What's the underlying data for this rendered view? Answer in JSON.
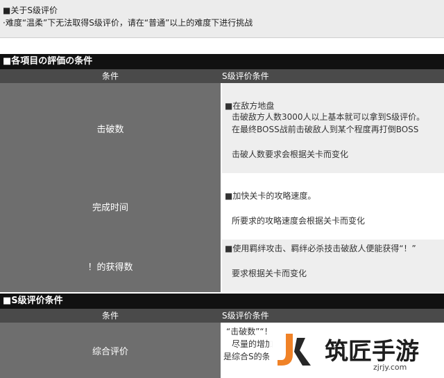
{
  "note": {
    "title": "■关于S级评价",
    "desc": "·难度“温柔”下无法取得S级评价，请在“普通”以上的难度下进行挑战"
  },
  "section1": {
    "title": "■各項目の評価の条件",
    "header": {
      "col1": "条件",
      "col2": "S级评价条件"
    },
    "rows": [
      {
        "label": "击破数",
        "lines": [
          "■在敌方地盘",
          "击破敌方人数3000人以上基本就可以拿到S级评价。",
          "在最终BOSS战前击破敌人到某个程度再打倒BOSS",
          "击破人数要求会根据关卡而变化"
        ]
      },
      {
        "label": "完成时间",
        "lines": [
          "■加快关卡的攻略速度。",
          "所要求的攻略速度会根据关卡而变化"
        ]
      },
      {
        "label": "！的获得数",
        "lines": [
          "■使用羁绊攻击、羁绊必杀技击破敌人便能获得“！”",
          "要求根据关卡而变化"
        ]
      }
    ]
  },
  "section2": {
    "title": "■S级评价条件",
    "header": {
      "col1": "条件",
      "col2": "S级评价条件"
    },
    "rows": [
      {
        "label": "综合评价",
        "lines": [
          "“击破数”“！",
          "尽量的增加",
          "是综合S的条"
        ]
      }
    ]
  },
  "watermark": {
    "name": "筑匠手游",
    "url": "zjrjy.com"
  }
}
